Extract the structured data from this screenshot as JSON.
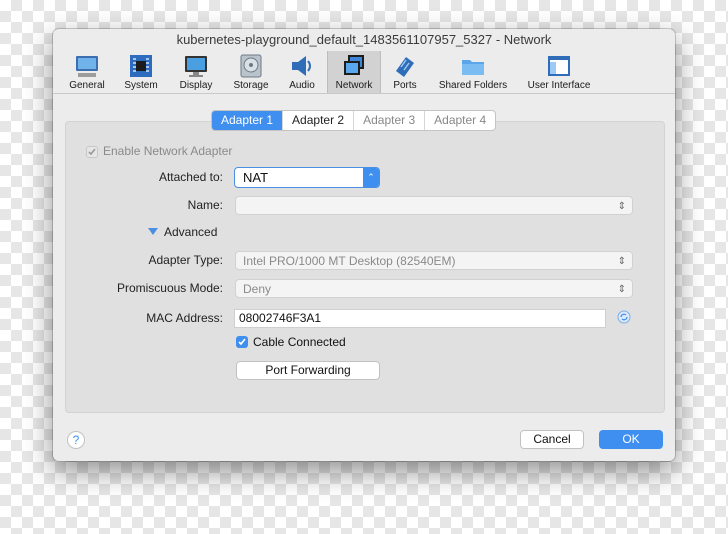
{
  "window": {
    "title": "kubernetes-playground_default_1483561107957_5327 - Network"
  },
  "toolbar": {
    "items": [
      {
        "label": "General",
        "icon": "general-icon"
      },
      {
        "label": "System",
        "icon": "system-icon"
      },
      {
        "label": "Display",
        "icon": "display-icon"
      },
      {
        "label": "Storage",
        "icon": "storage-icon"
      },
      {
        "label": "Audio",
        "icon": "audio-icon"
      },
      {
        "label": "Network",
        "icon": "network-icon",
        "selected": true
      },
      {
        "label": "Ports",
        "icon": "ports-icon"
      },
      {
        "label": "Shared Folders",
        "icon": "shared-folders-icon"
      },
      {
        "label": "User Interface",
        "icon": "user-interface-icon"
      }
    ]
  },
  "tabs": [
    "Adapter 1",
    "Adapter 2",
    "Adapter 3",
    "Adapter 4"
  ],
  "form": {
    "enable_label": "Enable Network Adapter",
    "attached_label": "Attached to:",
    "attached_value": "NAT",
    "name_label": "Name:",
    "name_value": "",
    "advanced_label": "Advanced",
    "adapter_type_label": "Adapter Type:",
    "adapter_type_value": "Intel PRO/1000 MT Desktop (82540EM)",
    "promiscuous_label": "Promiscuous Mode:",
    "promiscuous_value": "Deny",
    "mac_label": "MAC Address:",
    "mac_value": "08002746F3A1",
    "cable_label": "Cable Connected",
    "port_forwarding_label": "Port Forwarding"
  },
  "footer": {
    "help": "?",
    "cancel": "Cancel",
    "ok": "OK"
  },
  "colors": {
    "accent": "#3f8ff0"
  }
}
